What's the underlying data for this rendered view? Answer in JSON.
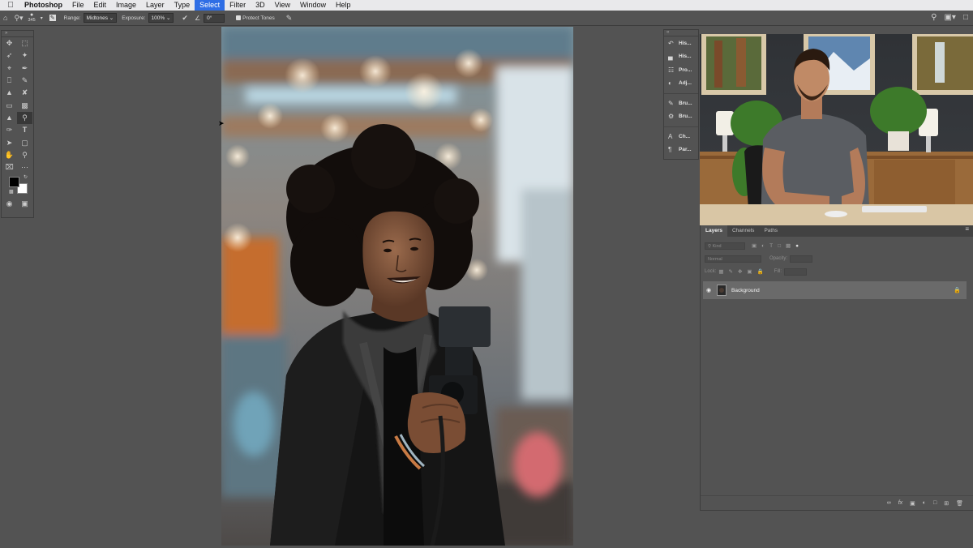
{
  "menubar": {
    "items": [
      "Photoshop",
      "File",
      "Edit",
      "Image",
      "Layer",
      "Type",
      "Select",
      "Filter",
      "3D",
      "View",
      "Window",
      "Help"
    ],
    "active": "Select"
  },
  "options": {
    "brush_size": "345",
    "range_label": "Range:",
    "range_value": "Midtones",
    "exposure_label": "Exposure:",
    "exposure_value": "100%",
    "angle_value": "0°",
    "protect_tones_label": "Protect Tones"
  },
  "dock": {
    "items": [
      {
        "icon": "history-icon",
        "label": "His..."
      },
      {
        "icon": "histogram-icon",
        "label": "His..."
      },
      {
        "icon": "properties-icon",
        "label": "Pro..."
      },
      {
        "icon": "adjustments-icon",
        "label": "Adj..."
      },
      {
        "icon": "brush-icon",
        "label": "Bru..."
      },
      {
        "icon": "brush-settings-icon",
        "label": "Bru..."
      },
      {
        "icon": "character-icon",
        "label": "Ch..."
      },
      {
        "icon": "paragraph-icon",
        "label": "Par..."
      }
    ]
  },
  "layers_panel": {
    "tabs": [
      "Layers",
      "Channels",
      "Paths"
    ],
    "active_tab": "Layers",
    "filter_placeholder": "Kind",
    "blend_mode": "Normal",
    "opacity_label": "Opacity:",
    "lock_label": "Lock:",
    "fill_label": "Fill:",
    "layers": [
      {
        "name": "Background",
        "visible": true,
        "locked": true
      }
    ]
  },
  "colors": {
    "foreground": "#000000",
    "background": "#ffffff",
    "ui_bg": "#535353",
    "menu_highlight": "#2f6ee5"
  }
}
